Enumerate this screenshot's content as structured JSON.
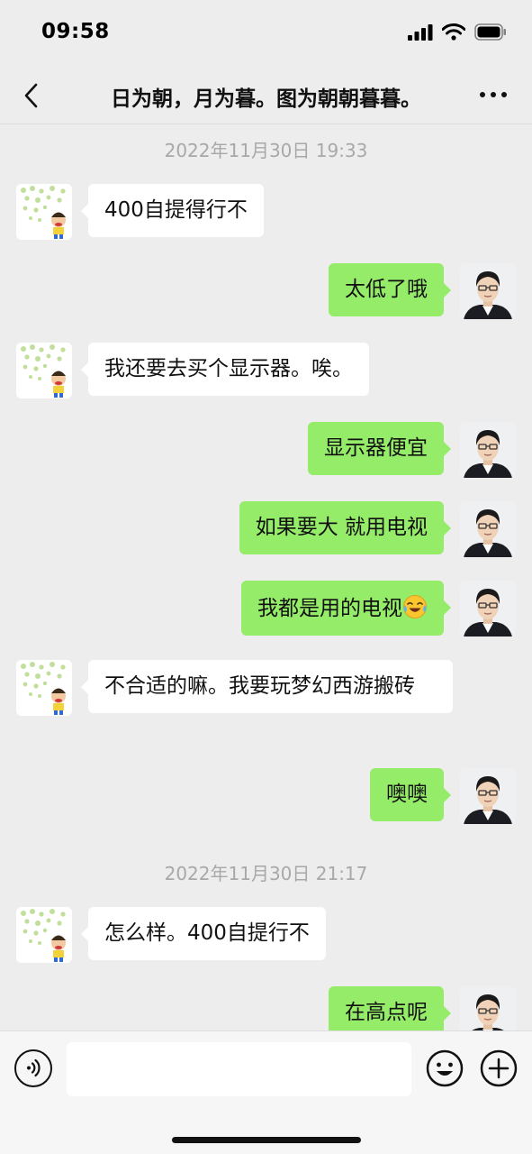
{
  "status_bar": {
    "time": "09:58"
  },
  "header": {
    "title": "日为朝，月为暮。图为朝朝暮暮。"
  },
  "timestamps": [
    "2022年11月30日 19:33",
    "2022年11月30日 21:17"
  ],
  "messages": [
    {
      "side": "left",
      "text": "400自提得行不"
    },
    {
      "side": "right",
      "text": "太低了哦"
    },
    {
      "side": "left",
      "text": "我还要去买个显示器。唉。"
    },
    {
      "side": "right",
      "text": "显示器便宜"
    },
    {
      "side": "right",
      "text": "如果要大 就用电视"
    },
    {
      "side": "right",
      "text": "我都是用的电视",
      "emoji": "laughing-crying-emoji"
    },
    {
      "side": "left",
      "text": "不合适的嘛。我要玩梦幻西游搬砖"
    },
    {
      "side": "right",
      "text": "噢噢"
    },
    {
      "side": "left",
      "text": "怎么样。400自提行不"
    },
    {
      "side": "right",
      "text": "在高点呢"
    }
  ],
  "input": {
    "value": "",
    "placeholder": ""
  },
  "icons": {
    "back": "chevron-left-icon",
    "more": "ellipsis-icon",
    "voice": "voice-icon",
    "emoji": "smiley-icon",
    "plus": "plus-icon"
  },
  "colors": {
    "background": "#ededed",
    "self_bubble": "#95ec69",
    "other_bubble": "#ffffff",
    "timestamp": "#a8a8a8",
    "input_bar": "#f6f6f6"
  }
}
